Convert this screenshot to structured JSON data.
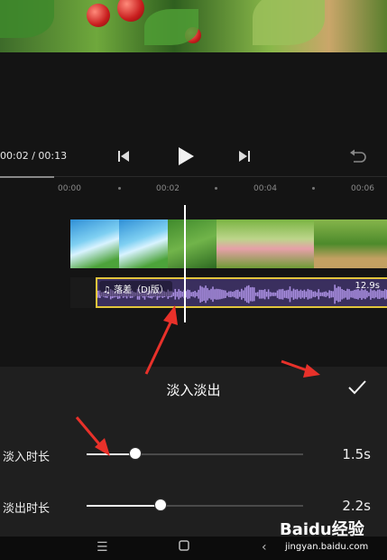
{
  "player": {
    "time_readout": "00:02 / 00:13",
    "prev_icon": "skip-previous-icon",
    "play_icon": "play-icon",
    "next_icon": "skip-next-icon",
    "undo_icon": "undo-icon"
  },
  "ruler": {
    "ticks": [
      "00:00",
      "00:02",
      "00:04",
      "00:06"
    ]
  },
  "audio": {
    "name": "落差（DJ版）",
    "duration": "12.9s",
    "icon": "music-note-icon"
  },
  "panel": {
    "title": "淡入淡出",
    "confirm_icon": "check-icon",
    "fade_in": {
      "label": "淡入时长",
      "value": "1.5s",
      "level": 0.23
    },
    "fade_out": {
      "label": "淡出时长",
      "value": "2.2s",
      "level": 0.345
    }
  },
  "system_nav": {
    "menu_icon": "menu-icon",
    "home_icon": "home-icon",
    "back_icon": "back-icon"
  },
  "watermark": {
    "text": "Baidu经验",
    "url": "jingyan.baidu.com"
  },
  "colors": {
    "audio_border": "#e2c53c",
    "audio_bg": "#3a2f5e",
    "wave": "#a98ee0",
    "annotation": "#e8312a"
  }
}
